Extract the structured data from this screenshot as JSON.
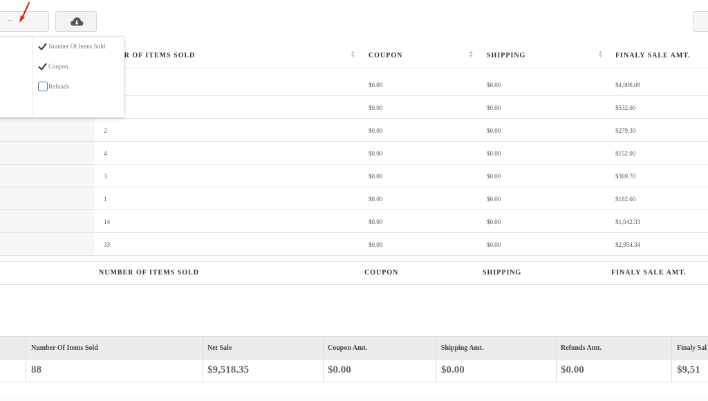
{
  "columns": {
    "items_sold": "NUMBER OF ITEMS SOLD",
    "items_sold_clipped": "ER OF ITEMS SOLD",
    "coupon": "COUPON",
    "shipping": "SHIPPING",
    "final_sale": "FINALY SALE AMT."
  },
  "column_menu": {
    "items": [
      {
        "label": "Number Of Items Sold",
        "checked": true
      },
      {
        "label": "Coupon",
        "checked": true
      },
      {
        "label": "Refunds",
        "checked": false
      }
    ]
  },
  "rows": [
    {
      "items": "",
      "coupon": "$0.00",
      "shipping": "$0.00",
      "final": "$4,006.08"
    },
    {
      "items": "",
      "coupon": "$0.00",
      "shipping": "$0.00",
      "final": "$532.00"
    },
    {
      "items": "2",
      "coupon": "$0.00",
      "shipping": "$0.00",
      "final": "$279.30"
    },
    {
      "items": "4",
      "coupon": "$0.00",
      "shipping": "$0.00",
      "final": "$152.00"
    },
    {
      "items": "3",
      "coupon": "$0.00",
      "shipping": "$0.00",
      "final": "$369.70"
    },
    {
      "items": "1",
      "coupon": "$0.00",
      "shipping": "$0.00",
      "final": "$182.60"
    },
    {
      "items": "14",
      "coupon": "$0.00",
      "shipping": "$0.00",
      "final": "$1,042.33"
    },
    {
      "items": "33",
      "coupon": "$0.00",
      "shipping": "$0.00",
      "final": "$2,954.34"
    }
  ],
  "summary": {
    "headers": [
      "Number Of Items Sold",
      "Net Sale",
      "Coupon Amt.",
      "Shipping Amt.",
      "Refunds Amt.",
      "Finaly Sal"
    ],
    "values": [
      "88",
      "$9,518.35",
      "$0.00",
      "$0.00",
      "$0.00",
      "$9,51"
    ]
  },
  "colors": {
    "annotation_arrow": "#e8261c",
    "checkbox_border": "#3c78b4"
  },
  "icons": {
    "download": "cloud-download-icon",
    "chevron": "chevron-down-icon",
    "check": "checkmark-icon"
  }
}
